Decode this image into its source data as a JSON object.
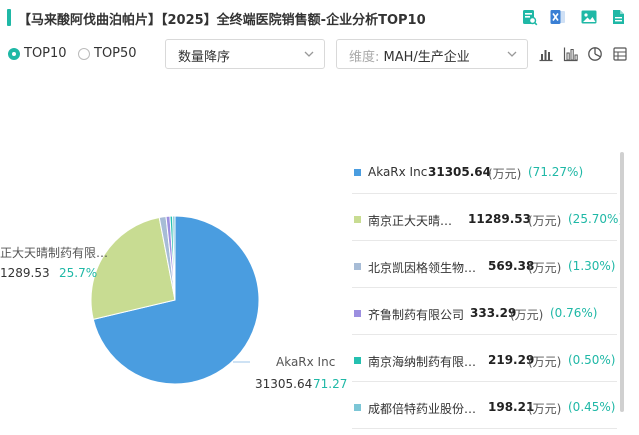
{
  "header": {
    "title": "【马来酸阿伐曲泊帕片】【2025】全终端医院销售额-企业分析TOP10",
    "icons": [
      "image-search-icon",
      "excel-export-icon",
      "image-export-icon",
      "document-icon"
    ]
  },
  "filters": {
    "radios": [
      {
        "label": "TOP10",
        "selected": true
      },
      {
        "label": "TOP50",
        "selected": false
      }
    ],
    "sort_select": {
      "value": "数量降序"
    },
    "dimension_select": {
      "prefix": "维度:",
      "value": "MAH/生产企业"
    },
    "view_icons": [
      "bar-chart-icon",
      "column-chart-icon",
      "pie-chart-icon",
      "table-icon"
    ]
  },
  "colors": {
    "accent": "#1fb8a6",
    "slices": [
      "#4a9de0",
      "#c8dc92",
      "#a7bcd6",
      "#9c8fe0",
      "#25c0b0",
      "#7cc6d6"
    ]
  },
  "chart_data": {
    "type": "pie",
    "unit": "(万元)",
    "slices": [
      {
        "name": "AkaRx Inc",
        "value": 31305.64,
        "value_text": "31305.64",
        "pct_text": "(71.27%)",
        "color": "#4a9de0"
      },
      {
        "name": "南京正大天晴…",
        "value": 11289.53,
        "value_text": "11289.53",
        "pct_text": "(25.70%)",
        "color": "#c8dc92"
      },
      {
        "name": "北京凯因格领生物…",
        "value": 569.38,
        "value_text": "569.38",
        "pct_text": "(1.30%)",
        "color": "#a7bcd6"
      },
      {
        "name": "齐鲁制药有限公司",
        "value": 333.29,
        "value_text": "333.29",
        "pct_text": "(0.76%)",
        "color": "#9c8fe0"
      },
      {
        "name": "南京海纳制药有限…",
        "value": 219.29,
        "value_text": "219.29",
        "pct_text": "(0.50%)",
        "color": "#25c0b0"
      },
      {
        "name": "成都倍特药业股份…",
        "value": 198.21,
        "value_text": "198.21",
        "pct_text": "(0.45%)",
        "color": "#7cc6d6"
      }
    ],
    "callouts": [
      {
        "name": "AkaRx Inc",
        "value": "31305.64",
        "pct": "71.27"
      },
      {
        "name": "正大天晴制药有限…",
        "value": "1289.53",
        "pct": "25.7%"
      }
    ]
  }
}
